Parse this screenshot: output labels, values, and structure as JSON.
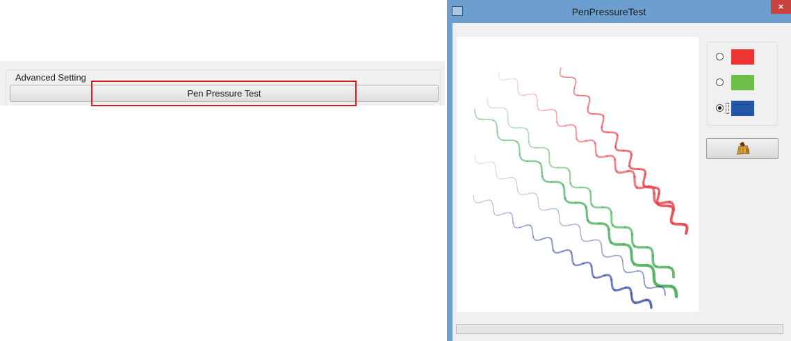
{
  "advanced": {
    "group_label": "Advanced Setting",
    "pen_test_label": "Pen Pressure Test"
  },
  "dialog": {
    "title": "PenPressureTest",
    "close_label": "×",
    "colors": [
      {
        "name": "red",
        "hex": "#ee3333",
        "selected": false
      },
      {
        "name": "green",
        "hex": "#6ebf4a",
        "selected": false
      },
      {
        "name": "blue",
        "hex": "#2456a8",
        "selected": true
      }
    ],
    "clear_icon": "broom-icon",
    "stroke_colors": {
      "red": "#e8424a",
      "green": "#49b05a",
      "blue": "#3a53a4"
    }
  }
}
